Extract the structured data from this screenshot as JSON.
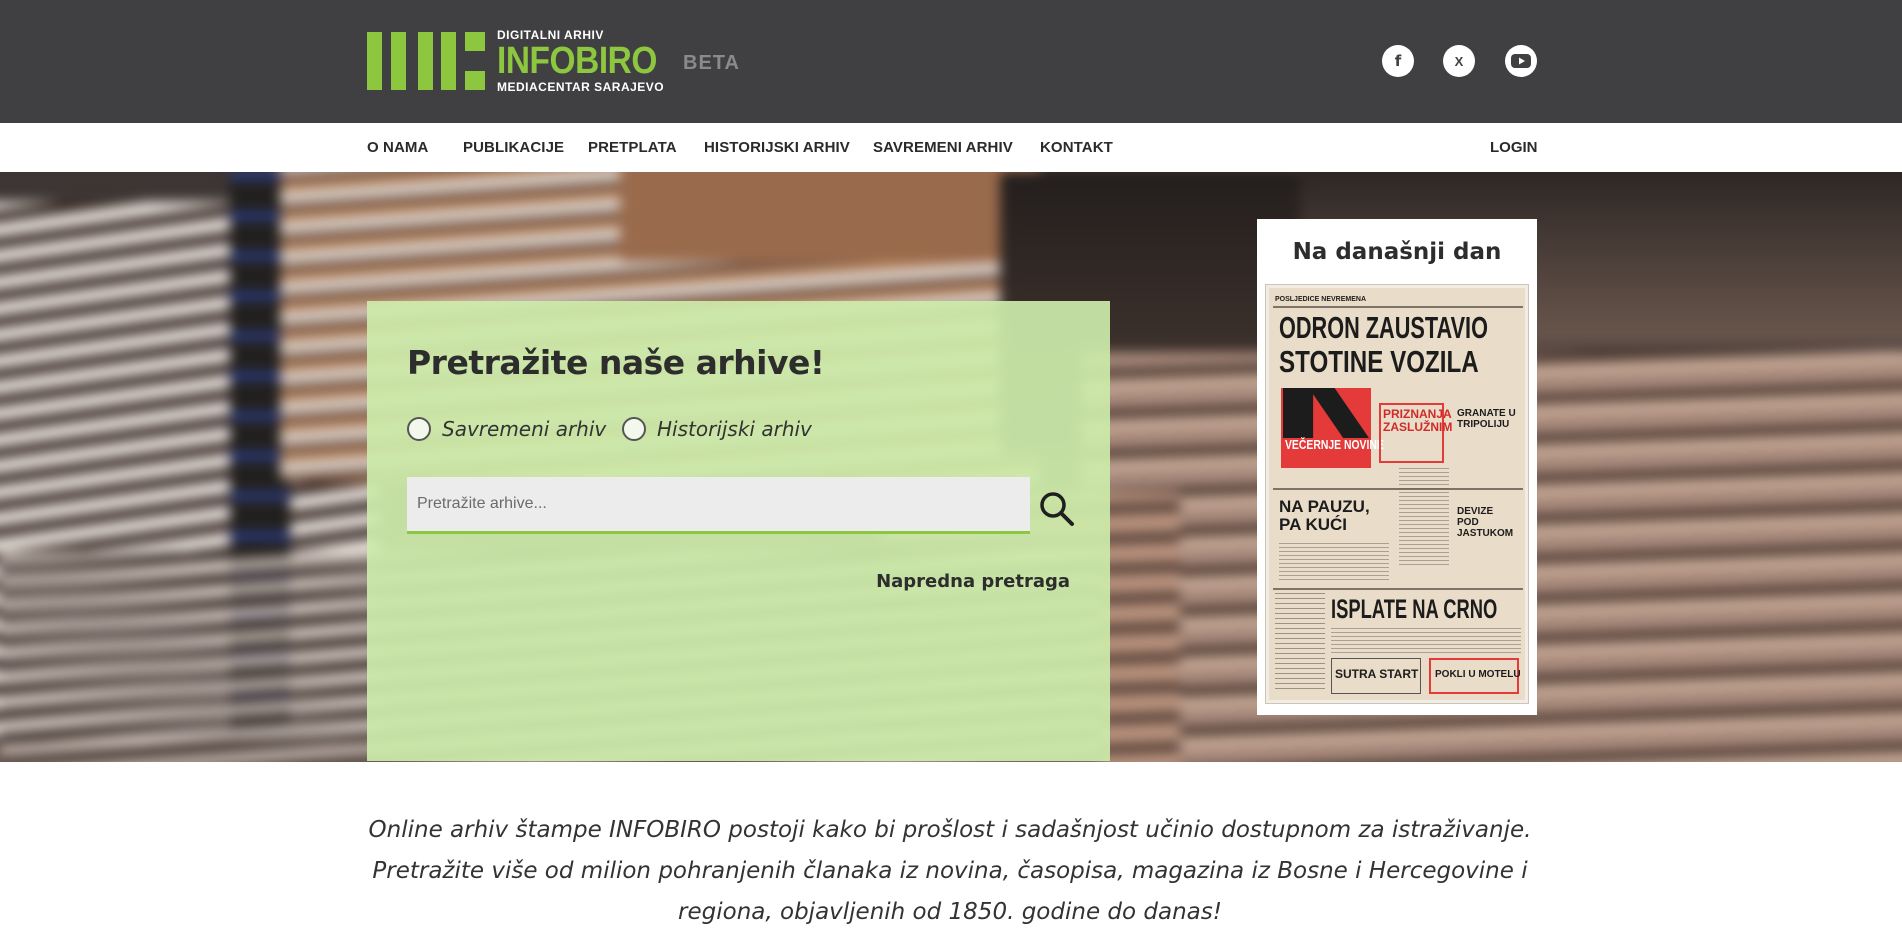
{
  "header": {
    "logo": {
      "line1": "DIGITALNI ARHIV",
      "brand": "INFOBIRO",
      "badge": "BETA",
      "line3": "MEDIACENTAR SARAJEVO"
    },
    "social": [
      {
        "icon": "facebook-icon",
        "glyph": "f"
      },
      {
        "icon": "x-twitter-icon",
        "glyph": "X"
      },
      {
        "icon": "youtube-icon",
        "glyph": "▶"
      }
    ]
  },
  "nav": {
    "items": [
      "O NAMA",
      "PUBLIKACIJE",
      "PRETPLATA",
      "HISTORIJSKI ARHIV",
      "SAVREMENI ARHIV",
      "KONTAKT"
    ],
    "login": "LOGIN"
  },
  "search": {
    "title": "Pretražite naše arhive!",
    "options": [
      "Savremeni arhiv",
      "Historijski arhiv"
    ],
    "placeholder": "Pretražite arhive...",
    "advanced": "Napredna pretraga"
  },
  "today": {
    "title": "Na današnji dan",
    "paper": {
      "kicker": "POSLJEDICE NEVREMENA",
      "headline1": "ODRON ZAUSTAVIO",
      "headline2": "STOTINE VOZILA",
      "masthead": "VEČERNJE NOVINE",
      "story1": "PRIZNANJA ZASLUŽNIM",
      "story2": "GRANATE U TRIPOLIJU",
      "story3": "NA PAUZU, PA KUĆI",
      "story4": "DEVIZE POD JASTUKOM",
      "story5": "ISPLATE NA CRNO",
      "story6": "SUTRA START",
      "story7": "POKLI U MOTELU"
    }
  },
  "intro": {
    "text": "Online arhiv štampe INFOBIRO postoji kako bi prošlost i sadašnjost učinio dostupnom za istraživanje. Pretražite više od milion pohranjenih članaka iz novina, časopisa, magazina iz Bosne i Hercegovine i regiona, objavljenih od 1850. godine do danas!"
  },
  "colors": {
    "brand_green": "#8dc63f",
    "header_bg": "#404042",
    "panel_green": "#cdebaa"
  }
}
